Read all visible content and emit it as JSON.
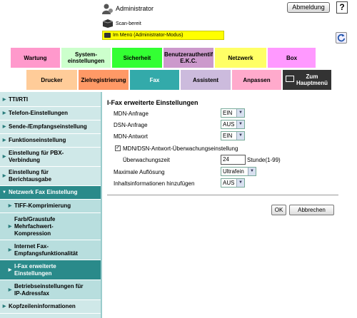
{
  "header": {
    "user": "Administrator",
    "logout_label": "Abmeldung",
    "help_label": "?",
    "status": "Scan-bereit",
    "mode": "Im Menü (Administrator-Modus)"
  },
  "tabs_row1": [
    "Wartung",
    "System-\neinstellungen",
    "Sicherheit",
    "Benutzerauthentif\nE.K.C.",
    "Netzwerk",
    "Box"
  ],
  "tabs_row2": [
    "Drucker",
    "Zielregistrierung",
    "Fax",
    "Assistent",
    "Anpassen",
    "Zum\nHauptmenü"
  ],
  "sidebar": {
    "items": [
      {
        "label": "TTI/RTI"
      },
      {
        "label": "Telefon-Einstellungen"
      },
      {
        "label": "Sende-/Empfangseinstellung"
      },
      {
        "label": "Funktionseinstellung"
      },
      {
        "label": "Einstellung für PBX-\nVerbindung"
      },
      {
        "label": "Einstellung für\nBerichtausgabe"
      },
      {
        "label": "Netzwerk Fax Einstellung"
      },
      {
        "label": "TIFF-Komprimierung"
      },
      {
        "label": "Farb/Graustufe\nMehrfachwert-\nKompression"
      },
      {
        "label": "Internet Fax-\nEmpfangsfunktionalität"
      },
      {
        "label": "I-Fax erweiterte\nEinstellungen"
      },
      {
        "label": "Betriebseinstellungen für\nIP-Adressfax"
      },
      {
        "label": "Kopfzeileninformationen"
      }
    ]
  },
  "main": {
    "title": "I-Fax erweiterte Einstellungen",
    "mdn_request": {
      "label": "MDN-Anfrage",
      "value": "EIN"
    },
    "dsn_request": {
      "label": "DSN-Anfrage",
      "value": "AUS"
    },
    "mdn_response": {
      "label": "MDN-Antwort",
      "value": "EIN"
    },
    "monitoring": {
      "label": "MDN/DSN-Antwort-Überwachungseinstellung",
      "checked": "✓"
    },
    "monitor_time": {
      "label": "Überwachungszeit",
      "value": "24",
      "unit": "Stunde(1-99)"
    },
    "max_resolution": {
      "label": "Maximale Auflösung",
      "value": "Ultrafein"
    },
    "content_info": {
      "label": "Inhaltsinformationen hinzufügen",
      "value": "AUS"
    },
    "ok_label": "OK",
    "cancel_label": "Abbrechen"
  }
}
